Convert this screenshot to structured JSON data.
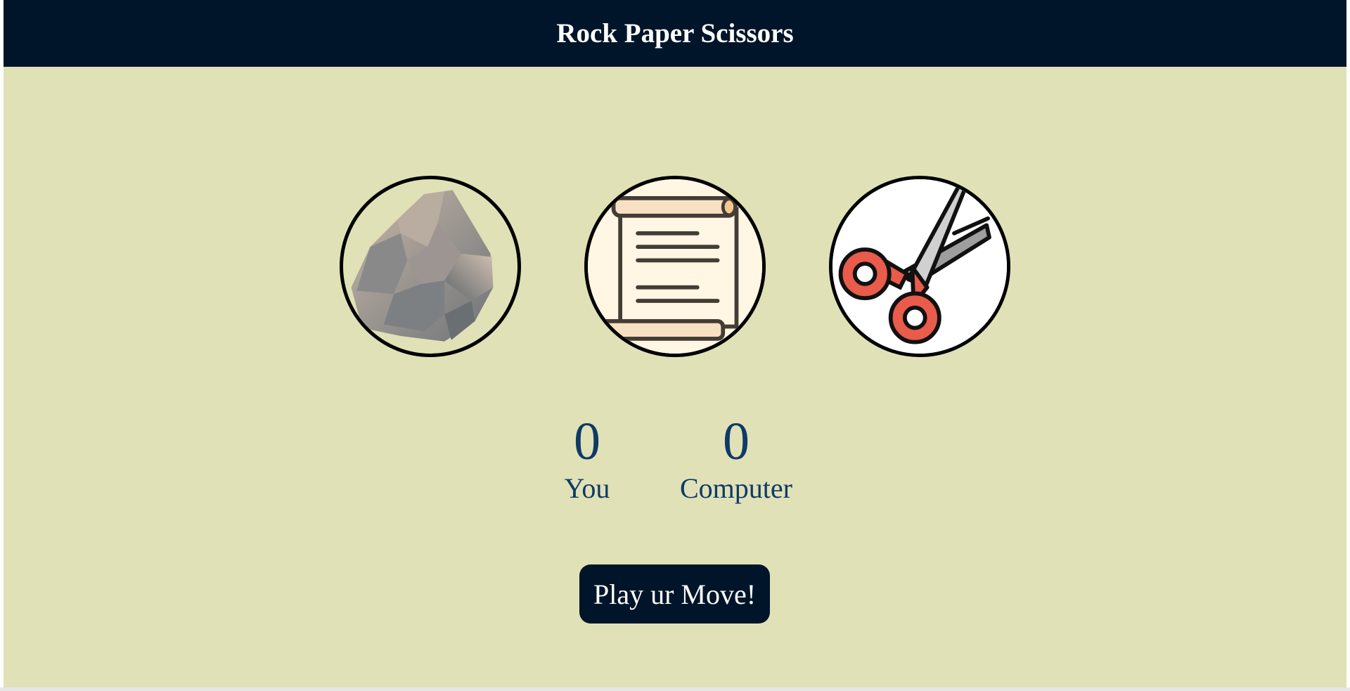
{
  "header": {
    "title": "Rock Paper Scissors"
  },
  "choices": [
    {
      "id": "rock",
      "icon": "rock-icon"
    },
    {
      "id": "paper",
      "icon": "scroll-paper-icon"
    },
    {
      "id": "scissors",
      "icon": "scissors-icon"
    }
  ],
  "scoreboard": {
    "user_score": "0",
    "user_label": "You",
    "computer_score": "0",
    "computer_label": "Computer"
  },
  "message": {
    "button_label": "Play ur Move!"
  },
  "colors": {
    "header_bg": "#001529",
    "page_bg": "#e1e1b7",
    "score_text": "#0e3a66",
    "button_bg": "#001529"
  }
}
